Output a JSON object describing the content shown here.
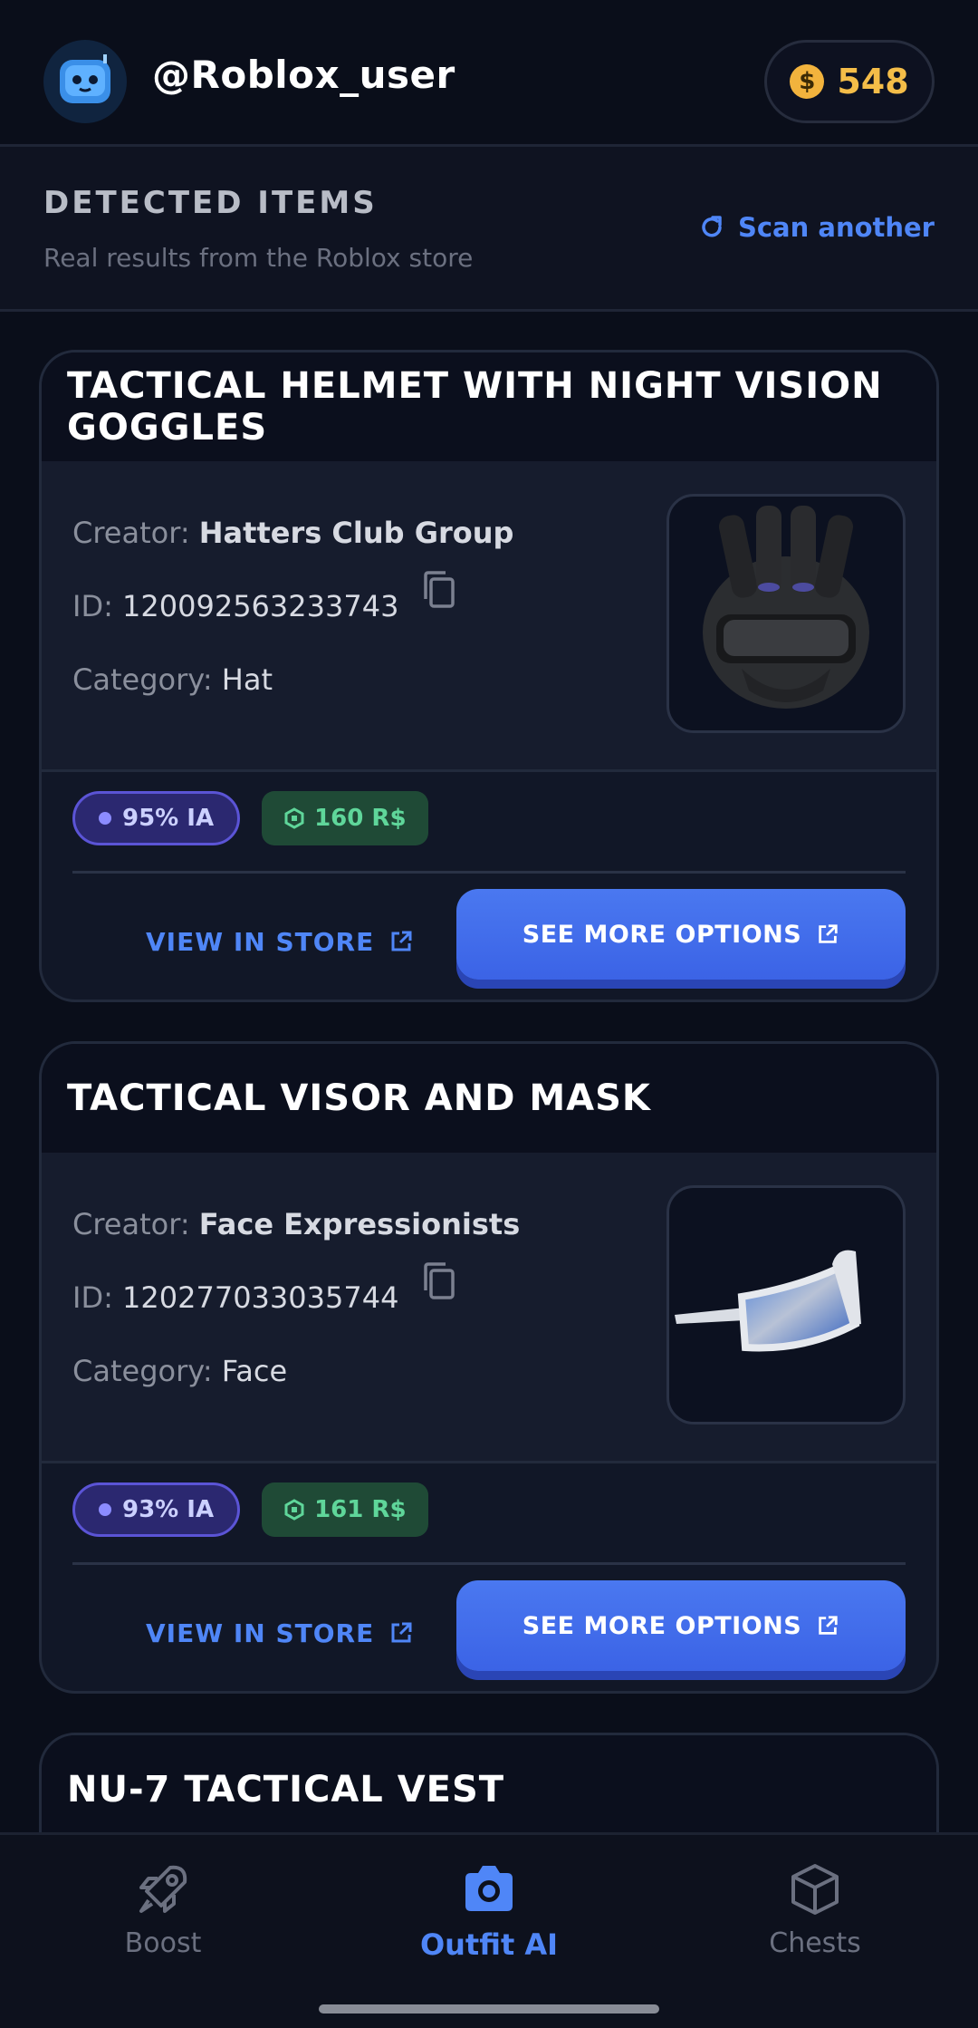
{
  "header": {
    "username": "@Roblox_user",
    "coins": "548",
    "coin_symbol": "$"
  },
  "section": {
    "title": "DETECTED ITEMS",
    "subtitle": "Real results from the Roblox store",
    "scan_label": "Scan another"
  },
  "items": [
    {
      "title": "TACTICAL HELMET WITH NIGHT VISION GOGGLES",
      "creator_label": "Creator:",
      "creator": "Hatters Club Group",
      "id_label": "ID:",
      "id": "120092563233743",
      "category_label": "Category:",
      "category": "Hat",
      "ia": "95% IA",
      "price": "160 R$",
      "view_label": "VIEW IN STORE",
      "more_label": "SEE MORE OPTIONS"
    },
    {
      "title": "TACTICAL VISOR AND MASK",
      "creator_label": "Creator:",
      "creator": "Face Expressionists",
      "id_label": "ID:",
      "id": "120277033035744",
      "category_label": "Category:",
      "category": "Face",
      "ia": "93% IA",
      "price": "161 R$",
      "view_label": "VIEW IN STORE",
      "more_label": "SEE MORE OPTIONS"
    },
    {
      "title": "NU-7 TACTICAL VEST"
    }
  ],
  "nav": {
    "items": [
      {
        "label": "Boost",
        "icon": "rocket-icon"
      },
      {
        "label": "Outfit AI",
        "icon": "camera-icon"
      },
      {
        "label": "Chests",
        "icon": "box-icon"
      }
    ],
    "active": "Outfit AI"
  },
  "colors": {
    "accent": "#4f86f7",
    "coin": "#f4bd48",
    "price": "#5fd69a",
    "background": "#0a0e1a"
  }
}
